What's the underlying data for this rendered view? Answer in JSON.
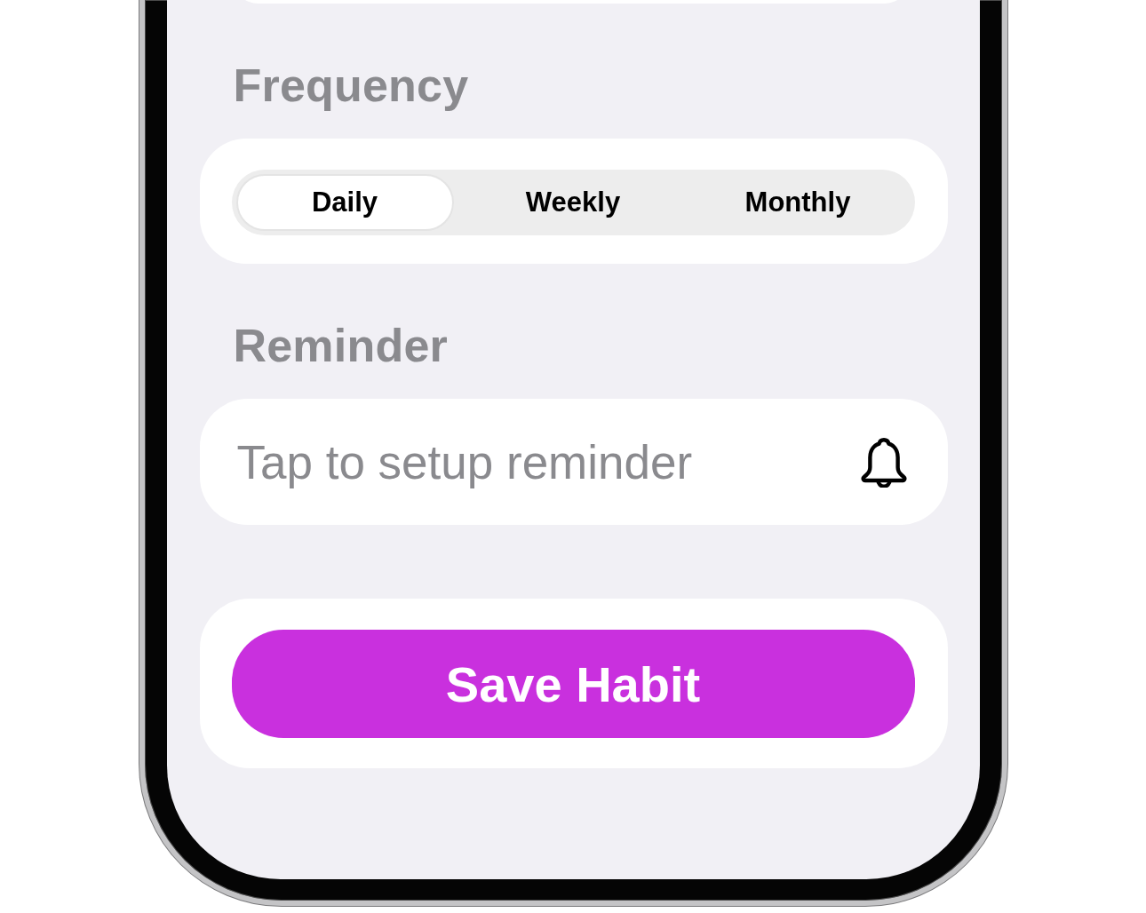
{
  "sections": [
    {
      "kind": "segmented",
      "heading": "Frequency",
      "options": [
        {
          "label": "Daily",
          "selected": true
        },
        {
          "label": "Weekly",
          "selected": false
        },
        {
          "label": "Monthly",
          "selected": false
        }
      ]
    },
    {
      "kind": "field",
      "heading": "Reminder",
      "placeholder": "Tap to setup reminder"
    }
  ],
  "save_button": {
    "label": "Save Habit"
  }
}
